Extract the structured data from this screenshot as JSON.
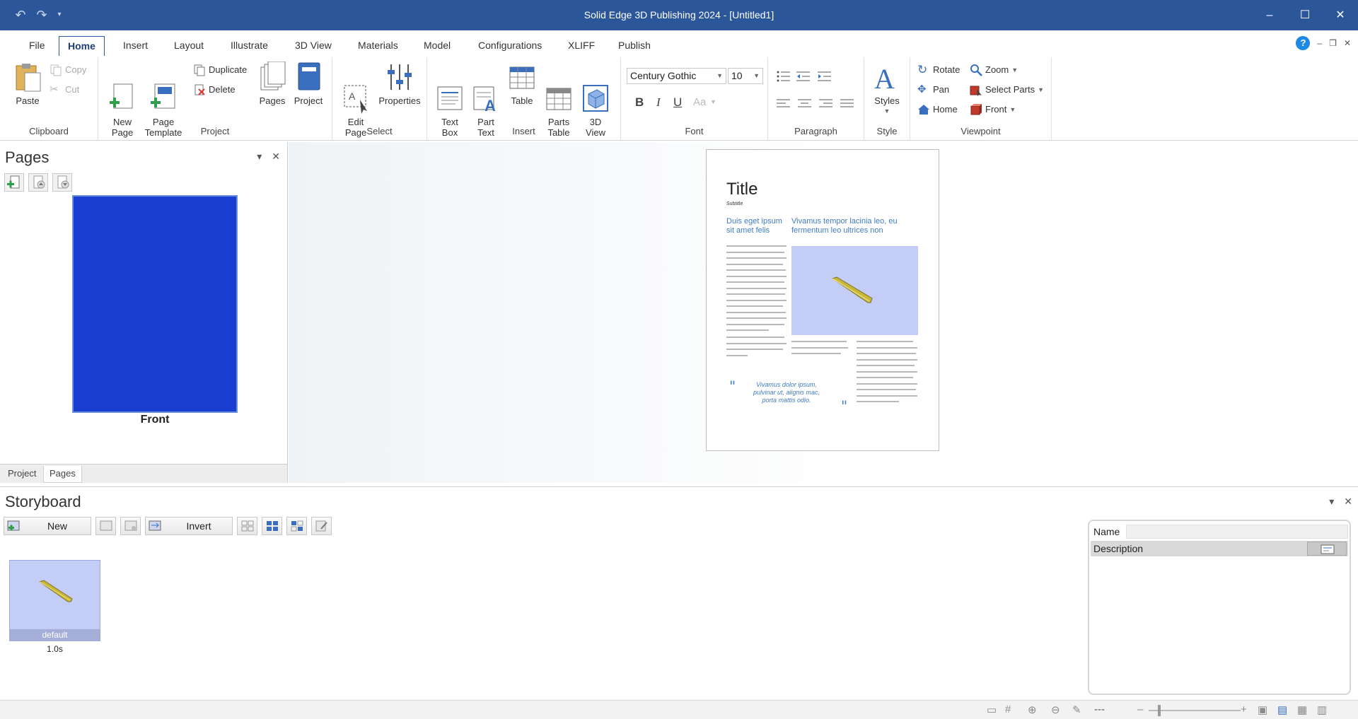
{
  "window": {
    "title": "Solid Edge 3D Publishing  2024 - [Untitled1]",
    "qat": [
      "undo-icon",
      "redo-icon",
      "customize-icon"
    ],
    "controls": [
      "–",
      "☐",
      "✕"
    ]
  },
  "tabs": [
    "File",
    "Home",
    "Insert",
    "Layout",
    "Illustrate",
    "3D View",
    "Materials",
    "Model",
    "Configurations",
    "XLIFF",
    "Publish"
  ],
  "active_tab": "Home",
  "ribbon": {
    "clipboard": {
      "label": "Clipboard",
      "paste": "Paste",
      "copy": "Copy",
      "cut": "Cut"
    },
    "project": {
      "label": "Project",
      "new_page": "New\nPage",
      "page_template": "Page\nTemplate",
      "duplicate": "Duplicate",
      "delete": "Delete",
      "pages": "Pages",
      "project": "Project"
    },
    "select": {
      "label": "Select",
      "edit_page": "Edit\nPage",
      "properties": "Properties"
    },
    "insert": {
      "label": "Insert",
      "text_box": "Text\nBox",
      "part_text": "Part\nText",
      "table": "Table",
      "parts_table": "Parts\nTable",
      "view_3d": "3D\nView"
    },
    "font": {
      "label": "Font",
      "family": "Century Gothic",
      "size": "10",
      "bold": "B",
      "italic": "I",
      "underline": "U",
      "color": "Aa"
    },
    "paragraph": {
      "label": "Paragraph"
    },
    "style": {
      "label": "Style",
      "styles": "Styles"
    },
    "viewpoint": {
      "label": "Viewpoint",
      "rotate": "Rotate",
      "zoom": "Zoom",
      "pan": "Pan",
      "select_parts": "Select Parts",
      "home": "Home",
      "front": "Front"
    }
  },
  "pages_panel": {
    "title": "Pages",
    "thumbnail_label": "Front",
    "bottom_tabs": [
      "Project",
      "Pages"
    ],
    "active_bottom_tab": "Pages",
    "thumbnail_color": "#1a3fd0"
  },
  "document": {
    "title": "Title",
    "subtitle": "Subtitle",
    "heading_left": "Duis eget ipsum sit amet felis",
    "heading_right": "Vivamus tempor lacinia leo, eu fermentum leo ultrices non",
    "quote": "Vivamus dolor ipsum, pulvinar ut, alignis mac, porta mattis odio.",
    "image_bg": "#c4cdf6"
  },
  "storyboard": {
    "title": "Storyboard",
    "new_label": "New",
    "invert_label": "Invert",
    "frame": {
      "name": "default",
      "time": "1.0s"
    },
    "props": {
      "name_label": "Name",
      "description_label": "Description"
    }
  },
  "statusbar": {
    "zoom_text": "---"
  },
  "colors": {
    "titlebar": "#2b579a",
    "accent": "#3f7cc0"
  }
}
